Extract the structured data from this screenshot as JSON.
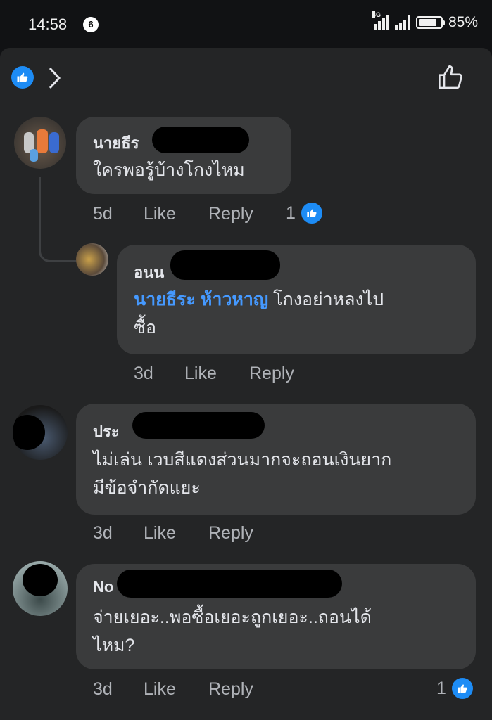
{
  "status_bar": {
    "time": "14:58",
    "notification_count": "6",
    "network": "4G",
    "battery": "85%",
    "battery_level": 0.85
  },
  "comments": [
    {
      "name_visible": "นายธีร",
      "text": "ใครพอรู้บ้างโกงไหม",
      "age": "5d",
      "like": "Like",
      "reply": "Reply",
      "reactions": "1"
    },
    {
      "name_visible": "อนน",
      "mention": "นายธีระ ห้าวหาญ",
      "text_line1": "โกงอย่าหลงไป",
      "text_line2": "ซื้อ",
      "age": "3d",
      "like": "Like",
      "reply": "Reply"
    },
    {
      "name_visible": "ประ",
      "text_line1": "ไม่เล่น เวบสีแดงส่วนมากจะถอนเงินยาก",
      "text_line2": "มีข้อจำกัดแยะ",
      "age": "3d",
      "like": "Like",
      "reply": "Reply"
    },
    {
      "name_visible": "No",
      "text_line1": "จ่ายเยอะ..พอซื้อเยอะถูกเยอะ..ถอนได้",
      "text_line2": "ไหม?",
      "age": "3d",
      "like": "Like",
      "reply": "Reply",
      "reactions": "1"
    }
  ],
  "colors": {
    "accent": "#1d8cf5",
    "mention": "#4599ff",
    "bubble": "#3a3b3c",
    "sheet": "#242526"
  }
}
